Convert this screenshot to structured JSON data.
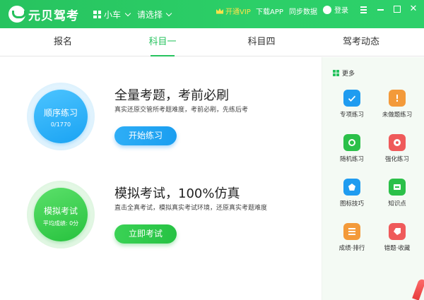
{
  "app": {
    "brand": "元贝驾考",
    "car_type": "小车",
    "city": "请选择",
    "vip_label": "开通VIP",
    "download_label": "下载APP",
    "sync_label": "同步数据",
    "login_label": "登录",
    "close_glyph": "✕"
  },
  "tabs": [
    {
      "label": "报名"
    },
    {
      "label": "科目一"
    },
    {
      "label": "科目四"
    },
    {
      "label": "驾考动态"
    }
  ],
  "main": {
    "practice": {
      "circle_title": "顺序练习",
      "circle_sub": "0/1770",
      "headline": "全量考题，考前必刷",
      "subline": "真实还原交管所考题难度，考前必刷，先练后考",
      "button": "开始练习"
    },
    "exam": {
      "circle_title": "模拟考试",
      "circle_sub": "平均成绩: 0分",
      "headline": "模拟考试，100%仿真",
      "subline": "直击全真考试，模拟真实考试环境，还原真实考题难度",
      "button": "立即考试"
    }
  },
  "side": {
    "more_label": "更多",
    "items": [
      {
        "label": "专项练习",
        "icon": "check-icon",
        "color": "#1f9cf0"
      },
      {
        "label": "未做题练习",
        "icon": "exclamation-icon",
        "color": "#f39a3a"
      },
      {
        "label": "随机练习",
        "icon": "shuffle-icon",
        "color": "#2bc049"
      },
      {
        "label": "强化练习",
        "icon": "target-icon",
        "color": "#ef5a5a"
      },
      {
        "label": "图标技巧",
        "icon": "pentagon-icon",
        "color": "#1f9cf0"
      },
      {
        "label": "知识点",
        "icon": "card-icon",
        "color": "#2bc049"
      },
      {
        "label": "成绩·排行",
        "icon": "list-icon",
        "color": "#f39a3a"
      },
      {
        "label": "错题·收藏",
        "icon": "tag-icon",
        "color": "#ef5a5a"
      }
    ]
  },
  "colors": {
    "brand_green": "#27c35f",
    "accent_blue": "#1a9ef0",
    "vip_yellow": "#ffe24a"
  }
}
